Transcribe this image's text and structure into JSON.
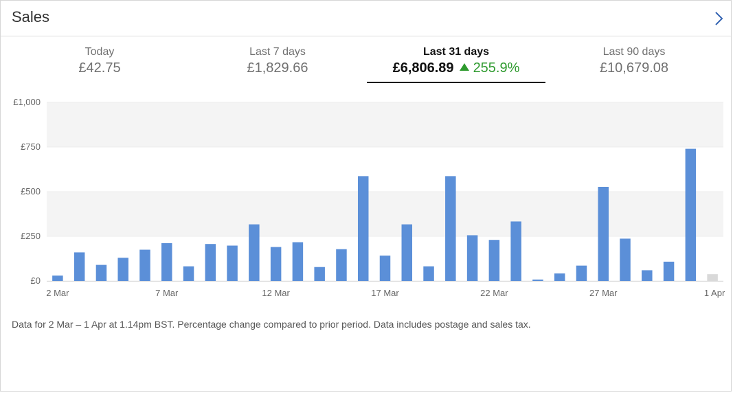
{
  "header": {
    "title": "Sales"
  },
  "tabs": [
    {
      "label": "Today",
      "value": "£42.75",
      "change": ""
    },
    {
      "label": "Last 7 days",
      "value": "£1,829.66",
      "change": ""
    },
    {
      "label": "Last 31 days",
      "value": "£6,806.89",
      "change": "255.9%"
    },
    {
      "label": "Last 90 days",
      "value": "£10,679.08",
      "change": ""
    }
  ],
  "colors": {
    "bar": "#5b8fd8",
    "bar_partial": "#d9d9d9",
    "positive": "#2e9a2e"
  },
  "chart_data": {
    "type": "bar",
    "categories": [
      "2 Mar",
      "3 Mar",
      "4 Mar",
      "5 Mar",
      "6 Mar",
      "7 Mar",
      "8 Mar",
      "9 Mar",
      "10 Mar",
      "11 Mar",
      "12 Mar",
      "13 Mar",
      "14 Mar",
      "15 Mar",
      "16 Mar",
      "17 Mar",
      "18 Mar",
      "19 Mar",
      "20 Mar",
      "21 Mar",
      "22 Mar",
      "23 Mar",
      "24 Mar",
      "25 Mar",
      "26 Mar",
      "27 Mar",
      "28 Mar",
      "29 Mar",
      "30 Mar",
      "31 Mar",
      "1 Apr"
    ],
    "values": [
      30,
      160,
      90,
      130,
      175,
      212,
      82,
      207,
      198,
      317,
      190,
      217,
      78,
      178,
      587,
      142,
      317,
      82,
      587,
      256,
      230,
      333,
      8,
      42,
      86,
      527,
      237,
      60,
      108,
      740,
      38
    ],
    "partial_index": 30,
    "x_tick_labels": [
      "2 Mar",
      "7 Mar",
      "12 Mar",
      "17 Mar",
      "22 Mar",
      "27 Mar",
      "1 Apr"
    ],
    "x_tick_indices": [
      0,
      5,
      10,
      15,
      20,
      25,
      30
    ],
    "y_tick_labels": [
      "£0",
      "£250",
      "£500",
      "£750",
      "£1,000"
    ],
    "y_tick_values": [
      0,
      250,
      500,
      750,
      1000
    ],
    "ylim": [
      0,
      1000
    ],
    "title": "",
    "xlabel": "",
    "ylabel": ""
  },
  "footnote": "Data for 2 Mar – 1 Apr at 1.14pm BST. Percentage change compared to prior period. Data includes postage and sales tax."
}
